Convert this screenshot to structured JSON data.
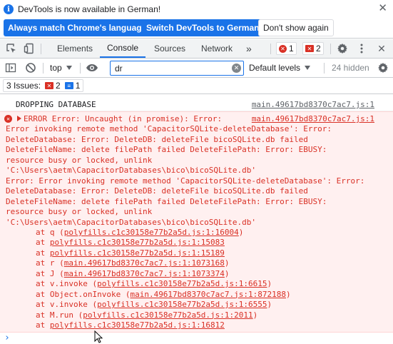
{
  "infobar": {
    "message": "DevTools is now available in German!",
    "btn_match": "Always match Chrome's language",
    "btn_switch": "Switch DevTools to German",
    "btn_dismiss": "Don't show again",
    "icon_glyph": "i",
    "close_glyph": "✕"
  },
  "tabs": {
    "items": [
      {
        "label": "Elements"
      },
      {
        "label": "Console",
        "active": true
      },
      {
        "label": "Sources"
      },
      {
        "label": "Network"
      }
    ],
    "more_glyph": "»",
    "errors_count": "1",
    "issues_count": "2",
    "close_glyph": "✕"
  },
  "toolbar": {
    "context": "top",
    "filter_value": "dr",
    "levels": "Default levels",
    "hidden": "24 hidden"
  },
  "issues": {
    "label": "3 Issues:",
    "error_count": "2",
    "info_count": "1"
  },
  "console": {
    "log": {
      "text": "DROPPING DATABASE",
      "source": "main.49617bd8370c7ac7.js:1"
    },
    "error": {
      "source": "main.49617bd8370c7ac7.js:1",
      "lines": [
        "ERROR Error: Uncaught (in promise): Error:",
        "Error invoking remote method 'CapacitorSQLite-deleteDatabase': Error:",
        "DeleteDatabase: Error: DeleteDB: deleteFile bicoSQLite.db failed",
        "DeleteFileName: delete filePath failed DeleteFilePath: Error: EBUSY:",
        "resource busy or locked, unlink",
        "'C:\\Users\\aetm\\CapacitorDatabases\\bico\\bicoSQLite.db'",
        "Error: Error invoking remote method 'CapacitorSQLite-deleteDatabase': Error:",
        "DeleteDatabase: Error: DeleteDB: deleteFile bicoSQLite.db failed",
        "DeleteFileName: delete filePath failed DeleteFilePath: Error: EBUSY:",
        "resource busy or locked, unlink",
        "'C:\\Users\\aetm\\CapacitorDatabases\\bico\\bicoSQLite.db'"
      ],
      "stack": [
        {
          "prefix": "at q (",
          "link": "polyfills.c1c30158e77b2a5d.js:1:16004",
          "suffix": ")"
        },
        {
          "prefix": "at ",
          "link": "polyfills.c1c30158e77b2a5d.js:1:15083",
          "suffix": ""
        },
        {
          "prefix": "at ",
          "link": "polyfills.c1c30158e77b2a5d.js:1:15189",
          "suffix": ""
        },
        {
          "prefix": "at r (",
          "link": "main.49617bd8370c7ac7.js:1:1073168",
          "suffix": ")"
        },
        {
          "prefix": "at J (",
          "link": "main.49617bd8370c7ac7.js:1:1073374",
          "suffix": ")"
        },
        {
          "prefix": "at v.invoke (",
          "link": "polyfills.c1c30158e77b2a5d.js:1:6615",
          "suffix": ")"
        },
        {
          "prefix": "at Object.onInvoke (",
          "link": "main.49617bd8370c7ac7.js:1:872188",
          "suffix": ")"
        },
        {
          "prefix": "at v.invoke (",
          "link": "polyfills.c1c30158e77b2a5d.js:1:6555",
          "suffix": ")"
        },
        {
          "prefix": "at M.run (",
          "link": "polyfills.c1c30158e77b2a5d.js:1:2011",
          "suffix": ")"
        },
        {
          "prefix": "at ",
          "link": "polyfills.c1c30158e77b2a5d.js:1:16812",
          "suffix": ""
        }
      ]
    },
    "prompt_glyph": "›"
  },
  "colors": {
    "accent": "#1a73e8",
    "error": "#d93025",
    "error_bg": "#fff0f0"
  }
}
